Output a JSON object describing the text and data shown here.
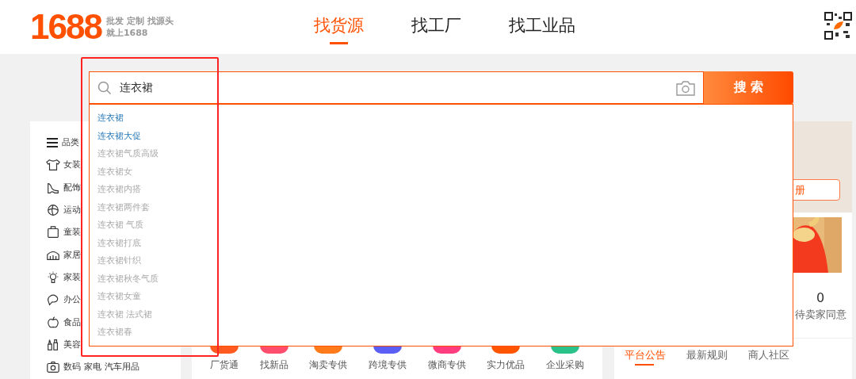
{
  "logo": {
    "text": "1688",
    "tagline": [
      "批发 定制 找源头",
      "就上1688"
    ]
  },
  "nav_tabs": [
    {
      "label": "找货源",
      "selected": true
    },
    {
      "label": "找工厂",
      "selected": false
    },
    {
      "label": "找工业品",
      "selected": false
    }
  ],
  "search": {
    "value": "连衣裙",
    "button": "搜 索"
  },
  "suggestions": [
    {
      "text": "连衣裙",
      "highlighted": true
    },
    {
      "text": "连衣裙大促",
      "highlighted": true
    },
    {
      "text": "连衣裙气质高级",
      "highlighted": false
    },
    {
      "text": "连衣裙女",
      "highlighted": false
    },
    {
      "text": "连衣裙内搭",
      "highlighted": false
    },
    {
      "text": "连衣裙两件套",
      "highlighted": false
    },
    {
      "text": "连衣裙 气质",
      "highlighted": false
    },
    {
      "text": "连衣裙打底",
      "highlighted": false
    },
    {
      "text": "连衣裙针织",
      "highlighted": false
    },
    {
      "text": "连衣裙秋冬气质",
      "highlighted": false
    },
    {
      "text": "连衣裙女童",
      "highlighted": false
    },
    {
      "text": "连衣裙 法式裙",
      "highlighted": false
    },
    {
      "text": "连衣裙春",
      "highlighted": false
    }
  ],
  "categories": {
    "title": "品类",
    "items": [
      [
        "女装"
      ],
      [
        "配饰"
      ],
      [
        "运动"
      ],
      [
        "童装"
      ],
      [
        "家居"
      ],
      [
        "家装"
      ],
      [
        "办公"
      ],
      [
        "食品"
      ],
      [
        "美容"
      ],
      [
        "数码",
        "家电",
        "汽车用品"
      ]
    ]
  },
  "services": [
    "厂货通",
    "找新品",
    "淘卖专供",
    "跨境专供",
    "微商专供",
    "实力优品",
    "企业采购"
  ],
  "account": {
    "register_button": "册",
    "count": "0",
    "count_label": "待卖家同意"
  },
  "news_tabs": [
    {
      "label": "平台公告",
      "selected": true
    },
    {
      "label": "最新规则",
      "selected": false
    },
    {
      "label": "商人社区",
      "selected": false
    }
  ]
}
